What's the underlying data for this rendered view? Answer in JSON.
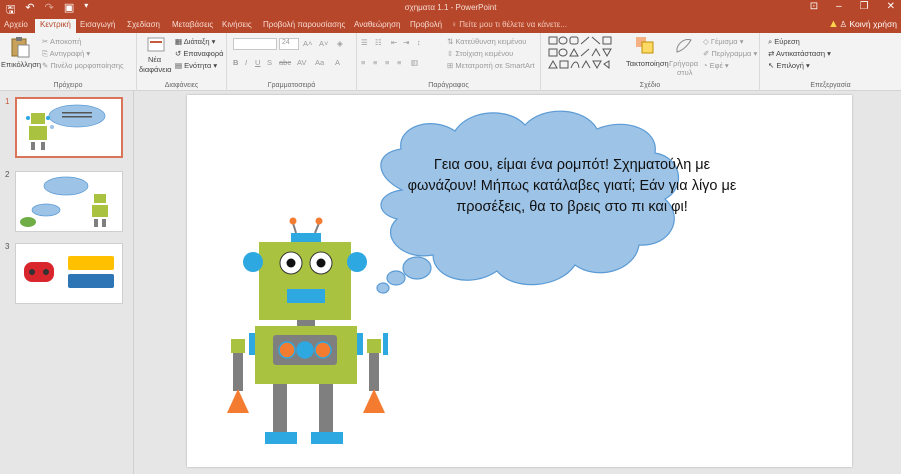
{
  "window": {
    "title": "σχηματα 1.1 - PowerPoint",
    "share_label": "Κοινή χρήση",
    "minimize": "–",
    "restore": "❐",
    "close": "✕"
  },
  "tabs": [
    "Αρχείο",
    "Κεντρική",
    "Εισαγωγή",
    "Σχεδίαση",
    "Μεταβάσεις",
    "Κινήσεις",
    "Προβολή παρουσίασης",
    "Αναθεώρηση",
    "Προβολή"
  ],
  "active_tab": "Κεντρική",
  "tell_me": "Πείτε μου τι θέλετε να κάνετε...",
  "ribbon": {
    "clipboard": {
      "label": "Πρόχειρο",
      "paste": "Επικόλληση",
      "cut": "Αποκοπή",
      "copy": "Αντιγραφή",
      "format_painter": "Πινέλο μορφοποίησης"
    },
    "slides": {
      "label": "Διαφάνειες",
      "new_slide": "Νέα",
      "new_slide_2": "διαφάνεια",
      "layout": "Διάταξη",
      "reset": "Επαναφορά",
      "section": "Ενότητα"
    },
    "font": {
      "label": "Γραμματοσειρά",
      "size": "24"
    },
    "paragraph": {
      "label": "Παράγραφος",
      "text_direction": "Κατεύθυνση κειμένου",
      "align_text": "Στοίχιση κειμένου",
      "smartart": "Μετατροπή σε SmartArt"
    },
    "drawing": {
      "label": "Σχέδιο",
      "arrange": "Τακτοποίηση",
      "quick_styles": "Γρήγορα",
      "quick_styles_2": "στυλ",
      "fill": "Γέμισμα",
      "outline": "Περίγραμμα",
      "effects": "Εφέ"
    },
    "editing": {
      "label": "Επεξεργασία",
      "find": "Εύρεση",
      "replace": "Αντικατάσταση",
      "select": "Επιλογή"
    }
  },
  "thumbnails": [
    {
      "number": "1",
      "selected": true
    },
    {
      "number": "2",
      "selected": false
    },
    {
      "number": "3",
      "selected": false
    }
  ],
  "slide": {
    "speech_text": "Γεια σου, είμαι ένα ρομπότ! Σχηματούλη με φωνάζουν! Μήπως κατάλαβες γιατί; Εάν για λίγο με προσέξεις, θα το βρεις στο πι και φι!"
  },
  "colors": {
    "accent": "#b7472a",
    "cloud": "#9dc3e6",
    "cloud_border": "#5b9bd5",
    "robot_body": "#a9c23f",
    "robot_blue": "#2ea8e0",
    "robot_orange": "#f47c30",
    "robot_gray": "#7f7f7f"
  }
}
